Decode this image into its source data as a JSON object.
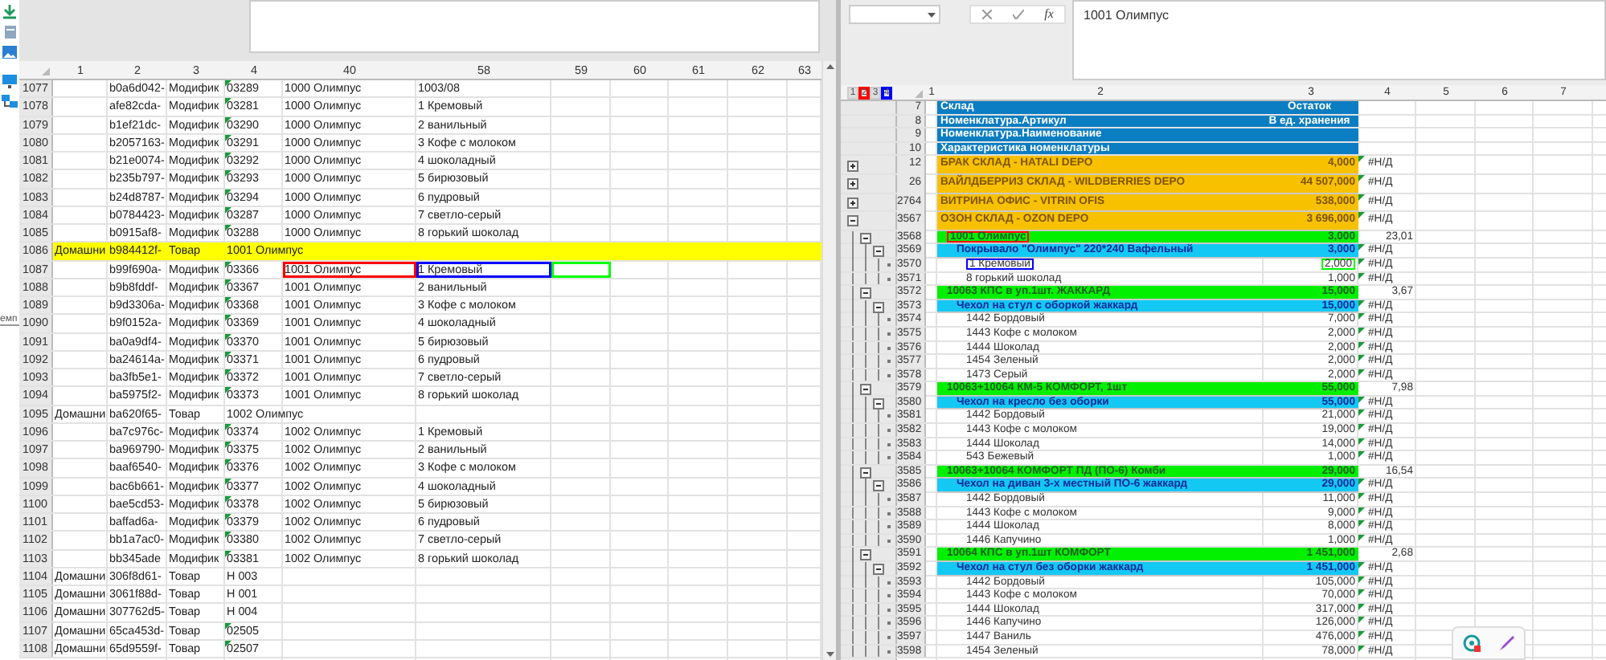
{
  "left_pane": {
    "side_label": "емп",
    "columns": [
      "1",
      "2",
      "3",
      "4",
      "40",
      "58",
      "59",
      "60",
      "61",
      "62",
      "63"
    ],
    "rows": [
      {
        "num": "1077",
        "col_2": "b0a6d042-",
        "col_3": "Модифик",
        "col_4": "03289",
        "col_40": "1000 Олимпус",
        "col_58": "1003/08",
        "flagged": true,
        "highlighted": false
      },
      {
        "num": "1078",
        "col_2": "afe82cda-",
        "col_3": "Модифик",
        "col_4": "03281",
        "col_40": "1000 Олимпус",
        "col_58": "1 Кремовый",
        "flagged": true,
        "highlighted": false
      },
      {
        "num": "1079",
        "col_2": "b1ef21dc-",
        "col_3": "Модифик",
        "col_4": "03290",
        "col_40": "1000 Олимпус",
        "col_58": "2 ванильный",
        "flagged": true,
        "highlighted": false
      },
      {
        "num": "1080",
        "col_2": "b2057163-",
        "col_3": "Модифик",
        "col_4": "03291",
        "col_40": "1000 Олимпус",
        "col_58": "3 Кофе с молоком",
        "flagged": true,
        "highlighted": false
      },
      {
        "num": "1081",
        "col_2": "b21e0074-",
        "col_3": "Модифик",
        "col_4": "03292",
        "col_40": "1000 Олимпус",
        "col_58": "4 шоколадный",
        "flagged": true,
        "highlighted": false
      },
      {
        "num": "1082",
        "col_2": "b235b797-",
        "col_3": "Модифик",
        "col_4": "03293",
        "col_40": "1000 Олимпус",
        "col_58": "5 бирюзовый",
        "flagged": true,
        "highlighted": false
      },
      {
        "num": "1083",
        "col_2": "b24d8787-",
        "col_3": "Модифик",
        "col_4": "03294",
        "col_40": "1000 Олимпус",
        "col_58": "6 пудровый",
        "flagged": true,
        "highlighted": false
      },
      {
        "num": "1084",
        "col_2": "b0784423-",
        "col_3": "Модифик",
        "col_4": "03287",
        "col_40": "1000 Олимпус",
        "col_58": "7 светло-серый",
        "flagged": true,
        "highlighted": false
      },
      {
        "num": "1085",
        "col_2": "b0915af8-",
        "col_3": "Модифик",
        "col_4": "03288",
        "col_40": "1000 Олимпус",
        "col_58": "8 горький шоколад",
        "flagged": true,
        "highlighted": false
      },
      {
        "num": "1086",
        "col_1": "Домашни",
        "col_2": "b984412f-",
        "col_3": "Товар",
        "col_4": "1001 Олимпус",
        "flagged": false,
        "highlighted": true
      },
      {
        "num": "1087",
        "col_2": "b99f690a-",
        "col_3": "Модифик",
        "col_4": "03366",
        "col_40": "1001 Олимпус",
        "col_58": "1 Кремовый",
        "flagged": true,
        "highlighted": false,
        "outlines": {
          "col_40": {
            "color": "#ff0000"
          },
          "col_58": {
            "color": "#0000ff"
          },
          "col_59": {
            "color": "#00ff00"
          }
        }
      },
      {
        "num": "1088",
        "col_2": "b9b8fddf-",
        "col_3": "Модифик",
        "col_4": "03367",
        "col_40": "1001 Олимпус",
        "col_58": "2 ванильный",
        "flagged": true,
        "highlighted": false
      },
      {
        "num": "1089",
        "col_2": "b9d3306a-",
        "col_3": "Модифик",
        "col_4": "03368",
        "col_40": "1001 Олимпус",
        "col_58": "3 Кофе с молоком",
        "flagged": true,
        "highlighted": false
      },
      {
        "num": "1090",
        "col_2": "b9f0152a-",
        "col_3": "Модифик",
        "col_4": "03369",
        "col_40": "1001 Олимпус",
        "col_58": "4 шоколадный",
        "flagged": true,
        "highlighted": false
      },
      {
        "num": "1091",
        "col_2": "ba0a9df4-",
        "col_3": "Модифик",
        "col_4": "03370",
        "col_40": "1001 Олимпус",
        "col_58": "5 бирюзовый",
        "flagged": true,
        "highlighted": false
      },
      {
        "num": "1092",
        "col_2": "ba24614a-",
        "col_3": "Модифик",
        "col_4": "03371",
        "col_40": "1001 Олимпус",
        "col_58": "6 пудровый",
        "flagged": true,
        "highlighted": false
      },
      {
        "num": "1093",
        "col_2": "ba3fb5e1-",
        "col_3": "Модифик",
        "col_4": "03372",
        "col_40": "1001 Олимпус",
        "col_58": "7 светло-серый",
        "flagged": true,
        "highlighted": false
      },
      {
        "num": "1094",
        "col_2": "ba5975f2-",
        "col_3": "Модифик",
        "col_4": "03373",
        "col_40": "1001 Олимпус",
        "col_58": "8 горький шоколад",
        "flagged": true,
        "highlighted": false
      },
      {
        "num": "1095",
        "col_1": "Домашни",
        "col_2": "ba620f65-",
        "col_3": "Товар",
        "col_4": "1002 Олимпус",
        "flagged": false,
        "highlighted": false
      },
      {
        "num": "1096",
        "col_2": "ba7c976c-",
        "col_3": "Модифик",
        "col_4": "03374",
        "col_40": "1002 Олимпус",
        "col_58": "1 Кремовый",
        "flagged": true,
        "highlighted": false
      },
      {
        "num": "1097",
        "col_2": "ba969790-",
        "col_3": "Модифик",
        "col_4": "03375",
        "col_40": "1002 Олимпус",
        "col_58": "2 ванильный",
        "flagged": true,
        "highlighted": false
      },
      {
        "num": "1098",
        "col_2": "baaf6540-",
        "col_3": "Модифик",
        "col_4": "03376",
        "col_40": "1002 Олимпус",
        "col_58": "3 Кофе с молоком",
        "flagged": true,
        "highlighted": false
      },
      {
        "num": "1099",
        "col_2": "bac6b661-",
        "col_3": "Модифик",
        "col_4": "03377",
        "col_40": "1002 Олимпус",
        "col_58": "4 шоколадный",
        "flagged": true,
        "highlighted": false
      },
      {
        "num": "1100",
        "col_2": "bae5cd53-",
        "col_3": "Модифик",
        "col_4": "03378",
        "col_40": "1002 Олимпус",
        "col_58": "5 бирюзовый",
        "flagged": true,
        "highlighted": false
      },
      {
        "num": "1101",
        "col_2": "baffad6a-",
        "col_3": "Модифик",
        "col_4": "03379",
        "col_40": "1002 Олимпус",
        "col_58": "6 пудровый",
        "flagged": true,
        "highlighted": false
      },
      {
        "num": "1102",
        "col_2": "bb1a7ac0-",
        "col_3": "Модифик",
        "col_4": "03380",
        "col_40": "1002 Олимпус",
        "col_58": "7 светло-серый",
        "flagged": true,
        "highlighted": false
      },
      {
        "num": "1103",
        "col_2": "bb345ade",
        "col_3": "Модифик",
        "col_4": "03381",
        "col_40": "1002 Олимпус",
        "col_58": "8 горький шоколад",
        "flagged": true,
        "highlighted": false
      },
      {
        "num": "1104",
        "col_1": "Домашни",
        "col_2": "306f8d61-",
        "col_3": "Товар",
        "col_4": "Н 003",
        "flagged": false,
        "highlighted": false
      },
      {
        "num": "1105",
        "col_1": "Домашни",
        "col_2": "3061f88d-",
        "col_3": "Товар",
        "col_4": "Н 001",
        "flagged": false,
        "highlighted": false
      },
      {
        "num": "1106",
        "col_1": "Домашни",
        "col_2": "307762d5-",
        "col_3": "Товар",
        "col_4": "Н 004",
        "flagged": false,
        "highlighted": false
      },
      {
        "num": "1107",
        "col_1": "Домашни",
        "col_2": "65ca453d-",
        "col_3": "Товар",
        "col_4": "02505",
        "flagged": true,
        "highlighted": false
      },
      {
        "num": "1108",
        "col_1": "Домашни",
        "col_2": "65d9559f-",
        "col_3": "Товар",
        "col_4": "02507",
        "flagged": true,
        "highlighted": false
      }
    ]
  },
  "right_pane": {
    "formula_bar": {
      "function_label": "fx",
      "value": "1001 Олимпус"
    },
    "outline_levels": [
      {
        "label": "1"
      },
      {
        "label": "2",
        "color": "#ff0000"
      },
      {
        "label": "3"
      },
      {
        "label": "4",
        "color": "#0000ff"
      }
    ],
    "columns": [
      "1",
      "2",
      "3",
      "4",
      "5",
      "6",
      "7"
    ],
    "rows": [
      {
        "num": "7",
        "kind": "header",
        "col_2": "Склад",
        "col_3": "Остаток",
        "flagged": false
      },
      {
        "num": "8",
        "kind": "header",
        "col_2": "Номенклатура.Артикул",
        "col_3": "В ед. хранения",
        "flagged": false
      },
      {
        "num": "9",
        "kind": "header",
        "col_2": "Номенклатура.Наименование",
        "flagged": false
      },
      {
        "num": "10",
        "kind": "header",
        "col_2": "Характеристика номенклатуры",
        "flagged": false
      },
      {
        "num": "12",
        "kind": "warehouse",
        "expanded": false,
        "col_2": "БРАК СКЛАД - HATALI DEPO",
        "col_3": "4,000",
        "col_4": "#Н/Д",
        "flagged": true
      },
      {
        "num": "26",
        "kind": "warehouse",
        "expanded": false,
        "col_2": "ВАЙЛДБЕРРИЗ СКЛАД - WILDBERRIES DEPO",
        "col_3": "44 507,000",
        "col_4": "#Н/Д",
        "flagged": true
      },
      {
        "num": "2764",
        "kind": "warehouse",
        "expanded": false,
        "col_2": "ВИТРИНА ОФИС - VITRIN OFIS",
        "col_3": "538,000",
        "col_4": "#Н/Д",
        "flagged": true
      },
      {
        "num": "3567",
        "kind": "warehouse",
        "expanded": true,
        "col_2": "ОЗОН СКЛАД - OZON DEPO",
        "col_3": "3 696,000",
        "col_4": "#Н/Д",
        "flagged": true
      },
      {
        "num": "3568",
        "kind": "product",
        "expanded": true,
        "col_2": "1001 Олимпус",
        "col_3": "3,000",
        "col_4": "23,01",
        "flagged": false,
        "outlines": {
          "col_2": {
            "color": "#ff0000"
          }
        }
      },
      {
        "num": "3569",
        "kind": "model",
        "expanded": true,
        "col_2": "Покрывало \"Олимпус\" 220*240 Вафельный",
        "col_3": "3,000",
        "col_4": "#Н/Д",
        "flagged": true
      },
      {
        "num": "3570",
        "kind": "variant",
        "col_2": "1 Кремовый",
        "col_3": "2,000",
        "col_4": "#Н/Д",
        "flagged": true,
        "outlines": {
          "col_2": {
            "color": "#0000ff"
          },
          "col_3": {
            "color": "#00ff00"
          }
        }
      },
      {
        "num": "3571",
        "kind": "variant",
        "col_2": "8 горький шоколад",
        "col_3": "1,000",
        "col_4": "#Н/Д",
        "flagged": true
      },
      {
        "num": "3572",
        "kind": "product",
        "expanded": true,
        "col_2": "10063 КПС в уп.1шт. ЖАККАРД",
        "col_3": "15,000",
        "col_4": "3,67",
        "flagged": false
      },
      {
        "num": "3573",
        "kind": "model",
        "expanded": true,
        "col_2": "Чехол на стул с оборкой жаккард",
        "col_3": "15,000",
        "col_4": "#Н/Д",
        "flagged": true
      },
      {
        "num": "3574",
        "kind": "variant",
        "col_2": "1442 Бордовый",
        "col_3": "7,000",
        "col_4": "#Н/Д",
        "flagged": true
      },
      {
        "num": "3575",
        "kind": "variant",
        "col_2": "1443 Кофе с молоком",
        "col_3": "2,000",
        "col_4": "#Н/Д",
        "flagged": true
      },
      {
        "num": "3576",
        "kind": "variant",
        "col_2": "1444 Шоколад",
        "col_3": "2,000",
        "col_4": "#Н/Д",
        "flagged": true
      },
      {
        "num": "3577",
        "kind": "variant",
        "col_2": "1454 Зеленый",
        "col_3": "2,000",
        "col_4": "#Н/Д",
        "flagged": true
      },
      {
        "num": "3578",
        "kind": "variant",
        "col_2": "1473 Серый",
        "col_3": "2,000",
        "col_4": "#Н/Д",
        "flagged": true
      },
      {
        "num": "3579",
        "kind": "product",
        "expanded": true,
        "col_2": "10063+10064 КМ-5 КОМФОРТ, 1шт",
        "col_3": "55,000",
        "col_4": "7,98",
        "flagged": false
      },
      {
        "num": "3580",
        "kind": "model",
        "expanded": true,
        "col_2": "Чехол на кресло без оборки",
        "col_3": "55,000",
        "col_4": "#Н/Д",
        "flagged": true
      },
      {
        "num": "3581",
        "kind": "variant",
        "col_2": "1442 Бордовый",
        "col_3": "21,000",
        "col_4": "#Н/Д",
        "flagged": true
      },
      {
        "num": "3582",
        "kind": "variant",
        "col_2": "1443 Кофе с молоком",
        "col_3": "19,000",
        "col_4": "#Н/Д",
        "flagged": true
      },
      {
        "num": "3583",
        "kind": "variant",
        "col_2": "1444 Шоколад",
        "col_3": "14,000",
        "col_4": "#Н/Д",
        "flagged": true
      },
      {
        "num": "3584",
        "kind": "variant",
        "col_2": "543 Бежевый",
        "col_3": "1,000",
        "col_4": "#Н/Д",
        "flagged": true
      },
      {
        "num": "3585",
        "kind": "product",
        "expanded": true,
        "col_2": "10063+10064 КОМФОРТ  ПД (ПО-6) Комби",
        "col_3": "29,000",
        "col_4": "16,54",
        "flagged": false
      },
      {
        "num": "3586",
        "kind": "model",
        "expanded": true,
        "col_2": "Чехол на диван 3-х местный ПО-6 жаккард",
        "col_3": "29,000",
        "col_4": "#Н/Д",
        "flagged": true
      },
      {
        "num": "3587",
        "kind": "variant",
        "col_2": "1442 Бордовый",
        "col_3": "11,000",
        "col_4": "#Н/Д",
        "flagged": true
      },
      {
        "num": "3588",
        "kind": "variant",
        "col_2": "1443 Кофе с молоком",
        "col_3": "9,000",
        "col_4": "#Н/Д",
        "flagged": true
      },
      {
        "num": "3589",
        "kind": "variant",
        "col_2": "1444 Шоколад",
        "col_3": "8,000",
        "col_4": "#Н/Д",
        "flagged": true
      },
      {
        "num": "3590",
        "kind": "variant",
        "col_2": "1446 Капучино",
        "col_3": "1,000",
        "col_4": "#Н/Д",
        "flagged": true
      },
      {
        "num": "3591",
        "kind": "product",
        "expanded": true,
        "col_2": "10064 КПС в уп.1шт КОМФОРТ",
        "col_3": "1 451,000",
        "col_4": "2,68",
        "flagged": false
      },
      {
        "num": "3592",
        "kind": "model",
        "expanded": true,
        "col_2": "Чехол на стул без оборки жаккард",
        "col_3": "1 451,000",
        "col_4": "#Н/Д",
        "flagged": true
      },
      {
        "num": "3593",
        "kind": "variant",
        "col_2": "1442 Бордовый",
        "col_3": "105,000",
        "col_4": "#Н/Д",
        "flagged": true
      },
      {
        "num": "3594",
        "kind": "variant",
        "col_2": "1443 Кофе с молоком",
        "col_3": "70,000",
        "col_4": "#Н/Д",
        "flagged": true
      },
      {
        "num": "3595",
        "kind": "variant",
        "col_2": "1444 Шоколад",
        "col_3": "317,000",
        "col_4": "#Н/Д",
        "flagged": true
      },
      {
        "num": "3596",
        "kind": "variant",
        "col_2": "1446 Капучино",
        "col_3": "126,000",
        "col_4": "#Н/Д",
        "flagged": true
      },
      {
        "num": "3597",
        "kind": "variant",
        "col_2": "1447 Ваниль",
        "col_3": "476,000",
        "col_4": "#Н/Д",
        "flagged": true
      },
      {
        "num": "3598",
        "kind": "variant",
        "col_2": "1454 Зеленый",
        "col_3": "78,000",
        "col_4": "#Н/Д",
        "flagged": true
      }
    ]
  }
}
